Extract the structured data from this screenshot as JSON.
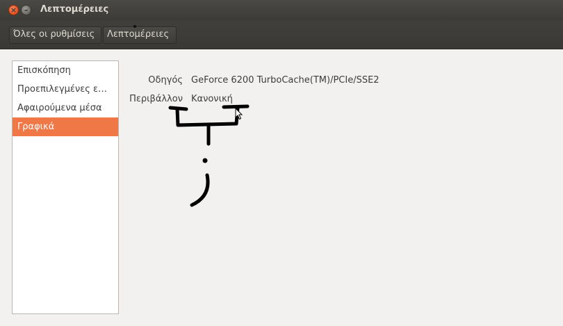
{
  "window": {
    "title": "Λεπτομέρειες"
  },
  "toolbar": {
    "all_settings_label": "Όλες οι ρυθμίσεις",
    "details_label": "Λεπτομέρειες"
  },
  "sidebar": {
    "items": [
      {
        "label": "Επισκόπηση"
      },
      {
        "label": "Προεπιλεγμένες ε…"
      },
      {
        "label": "Αφαιρούμενα μέσα"
      },
      {
        "label": "Γραφικά"
      }
    ],
    "selected_index": 3
  },
  "details": {
    "driver_label": "Οδηγός",
    "driver_value": "GeForce 6200 TurboCache(TM)/PCIe/SSE2",
    "environment_label": "Περιβάλλον",
    "environment_value": "Κανονική"
  },
  "colors": {
    "accent": "#f07746",
    "titlebar": "#3c3b37"
  }
}
